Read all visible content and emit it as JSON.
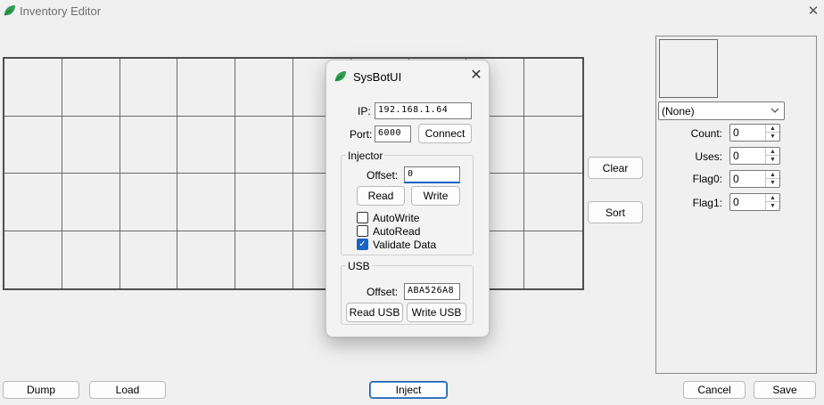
{
  "window": {
    "title": "Inventory Editor",
    "close_glyph": "✕"
  },
  "grid": {
    "rows": 4,
    "cols": 10
  },
  "middle_buttons": {
    "clear": "Clear",
    "sort": "Sort"
  },
  "bottom": {
    "dump": "Dump",
    "load": "Load",
    "inject": "Inject",
    "cancel": "Cancel",
    "save": "Save"
  },
  "item_panel": {
    "item_select": "(None)",
    "fields": [
      {
        "label": "Count:",
        "value": "0"
      },
      {
        "label": "Uses:",
        "value": "0"
      },
      {
        "label": "Flag0:",
        "value": "0"
      },
      {
        "label": "Flag1:",
        "value": "0"
      }
    ]
  },
  "dialog": {
    "title": "SysBotUI",
    "close_glyph": "✕",
    "ip_label": "IP:",
    "ip_value": "192.168.1.64",
    "port_label": "Port:",
    "port_value": "6000",
    "connect": "Connect",
    "injector": {
      "title": "Injector",
      "offset_label": "Offset:",
      "offset_value": "0",
      "read": "Read",
      "write": "Write",
      "checkboxes": [
        {
          "label": "AutoWrite",
          "checked": false
        },
        {
          "label": "AutoRead",
          "checked": false
        },
        {
          "label": "Validate Data",
          "checked": true
        }
      ]
    },
    "usb": {
      "title": "USB",
      "offset_label": "Offset:",
      "offset_value": "ABA526A8",
      "read_usb": "Read USB",
      "write_usb": "Write USB"
    }
  },
  "colors": {
    "accent": "#1763c5",
    "leaf": "#2f9e4f",
    "leaf_dark": "#1f7a3a"
  }
}
